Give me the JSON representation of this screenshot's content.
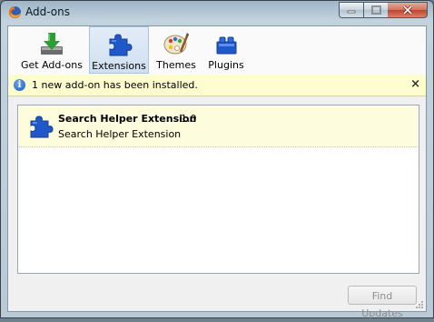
{
  "window": {
    "title": "Add-ons"
  },
  "toolbar": {
    "buttons": [
      {
        "label": "Get Add-ons",
        "icon": "download-icon"
      },
      {
        "label": "Extensions",
        "icon": "puzzle-icon",
        "selected": true
      },
      {
        "label": "Themes",
        "icon": "palette-icon"
      },
      {
        "label": "Plugins",
        "icon": "plugin-blocks-icon"
      }
    ]
  },
  "notification": {
    "message": "1 new add-on has been installed.",
    "close_label": "×"
  },
  "extensions": [
    {
      "name": "Search Helper Extension",
      "version": "1.0",
      "description": "Search Helper Extension"
    }
  ],
  "footer": {
    "find_updates_label": "Find Updates",
    "find_updates_enabled": false
  },
  "colors": {
    "accent_blue": "#1f58c9",
    "selected_tab": "#cfe0f1",
    "notification_bg": "#fefdcf",
    "item_selected_bg": "#fdfcdc"
  }
}
